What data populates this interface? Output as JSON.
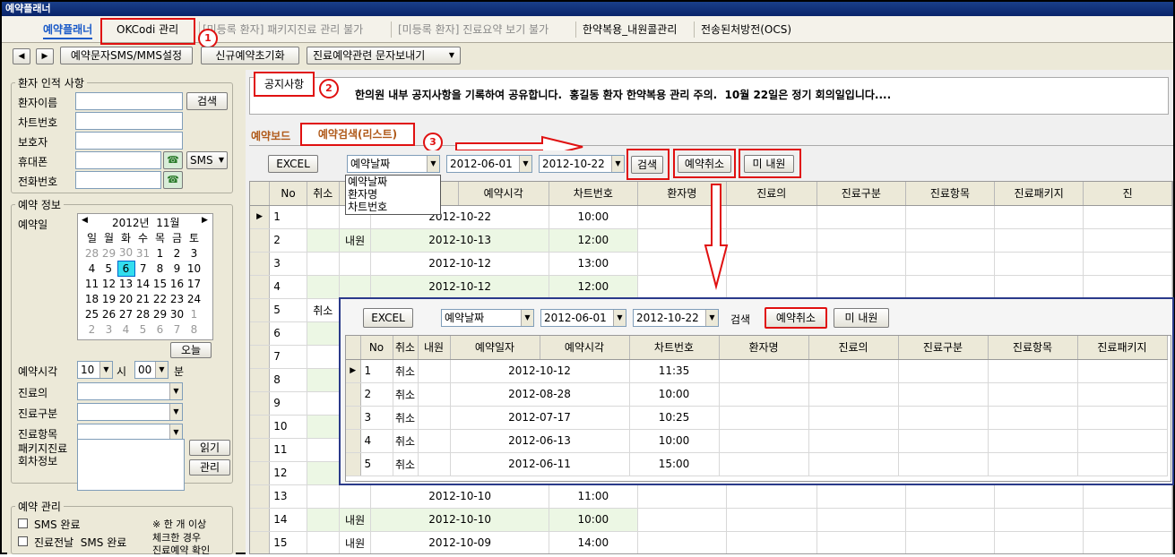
{
  "window": {
    "title": "예약플래너"
  },
  "top_tabs": [
    {
      "label": "예약플래너"
    },
    {
      "label": "OKCodi 관리"
    },
    {
      "label": "[미등록 환자] 패키지진료 관리 불가"
    },
    {
      "label": "[미등록 환자] 진료요약 보기 불가"
    },
    {
      "label": "한약복용_내원콜관리"
    },
    {
      "label": "전송된처방전(OCS)"
    }
  ],
  "toolbar": {
    "prev": "◀",
    "next": "▶",
    "sms_settings": "예약문자SMS/MMS설정",
    "reset_new": "신규예약초기화",
    "send_message": "진료예약관련 문자보내기"
  },
  "patient_info": {
    "title": "환자 인적 사항",
    "name_label": "환자이름",
    "chart_label": "차트번호",
    "guardian_label": "보호자",
    "mobile_label": "휴대폰",
    "phone_label": "전화번호",
    "search_btn": "검색",
    "sms_btn": "SMS"
  },
  "reservation_info": {
    "title": "예약 정보",
    "date_label": "예약일",
    "time_label": "예약시각",
    "hour": "10",
    "hour_unit": "시",
    "minute": "00",
    "minute_unit": "분",
    "doctor_label": "진료의",
    "category_label": "진료구분",
    "item_label": "진료항목",
    "package_label1": "패키지진료",
    "package_label2": "회차정보",
    "read_btn": "읽기",
    "manage_btn": "관리",
    "today_btn": "오늘"
  },
  "calendar": {
    "month_label": "2012년  11월",
    "weekdays": [
      "일",
      "월",
      "화",
      "수",
      "목",
      "금",
      "토"
    ],
    "weeks": [
      [
        "28",
        "29",
        "30",
        "31",
        "1",
        "2",
        "3"
      ],
      [
        "4",
        "5",
        "6",
        "7",
        "8",
        "9",
        "10"
      ],
      [
        "11",
        "12",
        "13",
        "14",
        "15",
        "16",
        "17"
      ],
      [
        "18",
        "19",
        "20",
        "21",
        "22",
        "23",
        "24"
      ],
      [
        "25",
        "26",
        "27",
        "28",
        "29",
        "30",
        "1"
      ],
      [
        "2",
        "3",
        "4",
        "5",
        "6",
        "7",
        "8"
      ]
    ]
  },
  "reservation_mgmt": {
    "title": "예약 관리",
    "sms_done": "SMS 완료",
    "day_before_sms": "진료전날  SMS 완료",
    "note1": "※ 한 개 이상",
    "note2": "체크한 경우",
    "note3": "진료예약 확인"
  },
  "notice": {
    "label": "공지사항",
    "text": "한의원 내부 공지사항을 기록하여 공유합니다.  홍길동 환자 한약복용 관리 주의.  10월 22일은 정기 회의일입니다...."
  },
  "sub_tabs": [
    {
      "label": "예약보드"
    },
    {
      "label": "예약검색(리스트)"
    }
  ],
  "search_bar": {
    "excel": "EXCEL",
    "field": "예약날짜",
    "from": "2012-06-01",
    "to": "2012-10-22",
    "search": "검색",
    "cancel": "예약취소",
    "no_visit": "미 내원"
  },
  "dropdown_options": [
    "예약날짜",
    "환자명",
    "차트번호"
  ],
  "annotations": [
    "1",
    "2",
    "3"
  ],
  "main_table": {
    "headers": [
      "No",
      "취소",
      "내원",
      "예약일자",
      "예약시각",
      "차트번호",
      "환자명",
      "진료의",
      "진료구분",
      "진료항목",
      "진료패키지",
      "진"
    ],
    "rows": [
      [
        "1",
        "",
        "",
        "2012-10-22",
        "10:00"
      ],
      [
        "2",
        "",
        "내원",
        "2012-10-13",
        "12:00"
      ],
      [
        "3",
        "",
        "",
        "2012-10-12",
        "13:00"
      ],
      [
        "4",
        "",
        "",
        "2012-10-12",
        "12:00"
      ],
      [
        "5",
        "취소",
        "",
        "",
        ""
      ],
      [
        "6",
        "",
        "",
        "",
        ""
      ],
      [
        "7",
        "",
        "",
        "",
        ""
      ],
      [
        "8",
        "",
        "",
        "",
        ""
      ],
      [
        "9",
        "",
        "",
        "",
        ""
      ],
      [
        "10",
        "",
        "",
        "",
        ""
      ],
      [
        "11",
        "",
        "",
        "",
        ""
      ],
      [
        "12",
        "",
        "",
        "",
        ""
      ],
      [
        "13",
        "",
        "",
        "2012-10-10",
        "11:00"
      ],
      [
        "14",
        "",
        "내원",
        "2012-10-10",
        "10:00"
      ],
      [
        "15",
        "",
        "내원",
        "2012-10-09",
        "14:00"
      ]
    ]
  },
  "popup": {
    "excel": "EXCEL",
    "field": "예약날짜",
    "from": "2012-06-01",
    "to": "2012-10-22",
    "search": "검색",
    "cancel": "예약취소",
    "no_visit": "미 내원",
    "headers": [
      "No",
      "취소",
      "내원",
      "예약일자",
      "예약시각",
      "차트번호",
      "환자명",
      "진료의",
      "진료구분",
      "진료항목",
      "진료패키지"
    ],
    "rows": [
      [
        "1",
        "취소",
        "",
        "2012-10-12",
        "11:35"
      ],
      [
        "2",
        "취소",
        "",
        "2012-08-28",
        "10:00"
      ],
      [
        "3",
        "취소",
        "",
        "2012-07-17",
        "10:25"
      ],
      [
        "4",
        "취소",
        "",
        "2012-06-13",
        "10:00"
      ],
      [
        "5",
        "취소",
        "",
        "2012-06-11",
        "15:00"
      ]
    ]
  }
}
